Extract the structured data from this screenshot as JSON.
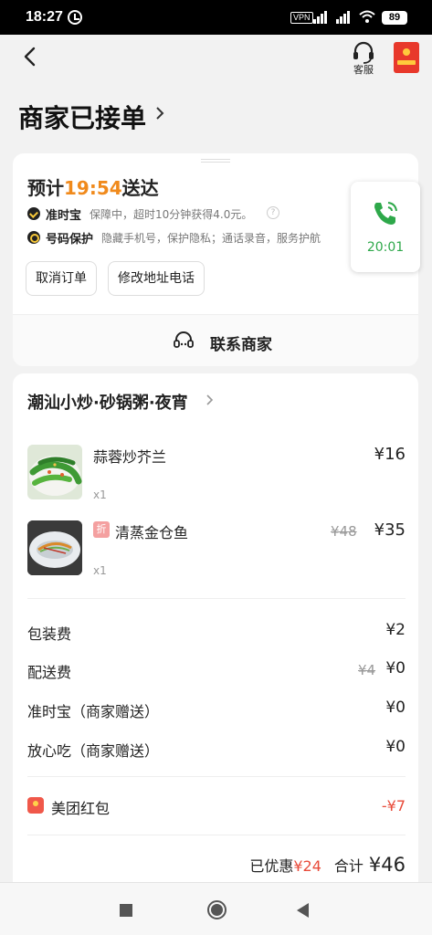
{
  "status_bar": {
    "time": "18:27",
    "vpn": "VPN",
    "battery": "89"
  },
  "header": {
    "customer_service": "客服"
  },
  "order": {
    "title": "商家已接单"
  },
  "delivery": {
    "eta_prefix": "预计",
    "eta_time": "19:54",
    "eta_suffix": "送达",
    "ontime_label": "准时宝",
    "ontime_text": "保障中，超时10分钟获得4.0元。",
    "privacy_label": "号码保护",
    "privacy_text": "隐藏手机号，保护隐私；通话录音，服务护航",
    "cancel_button": "取消订单",
    "modify_button": "修改地址电话",
    "call_time": "20:01",
    "contact_merchant": "联系商家"
  },
  "shop": {
    "name": "潮汕小炒·砂锅粥·夜宵",
    "items": [
      {
        "name": "蒜蓉炒芥兰",
        "qty": "x1",
        "price": "¥16"
      },
      {
        "name": "清蒸金仓鱼",
        "qty": "x1",
        "price": "¥35",
        "original_price": "¥48",
        "tag": "折"
      }
    ],
    "fees": [
      {
        "label": "包装费",
        "value": "¥2"
      },
      {
        "label": "配送费",
        "value": "¥0",
        "original": "¥4"
      },
      {
        "label": "准时宝（商家赠送）",
        "value": "¥0"
      },
      {
        "label": "放心吃（商家赠送）",
        "value": "¥0"
      }
    ],
    "red_packet": {
      "label": "美团红包",
      "value": "-¥7"
    },
    "summary": {
      "discount_label": "已优惠",
      "discount": "¥24",
      "total_label": "合计",
      "total": "¥46"
    }
  },
  "colors": {
    "accent": "#f08a1c",
    "red": "#e84b3a",
    "green": "#2ea84a"
  }
}
